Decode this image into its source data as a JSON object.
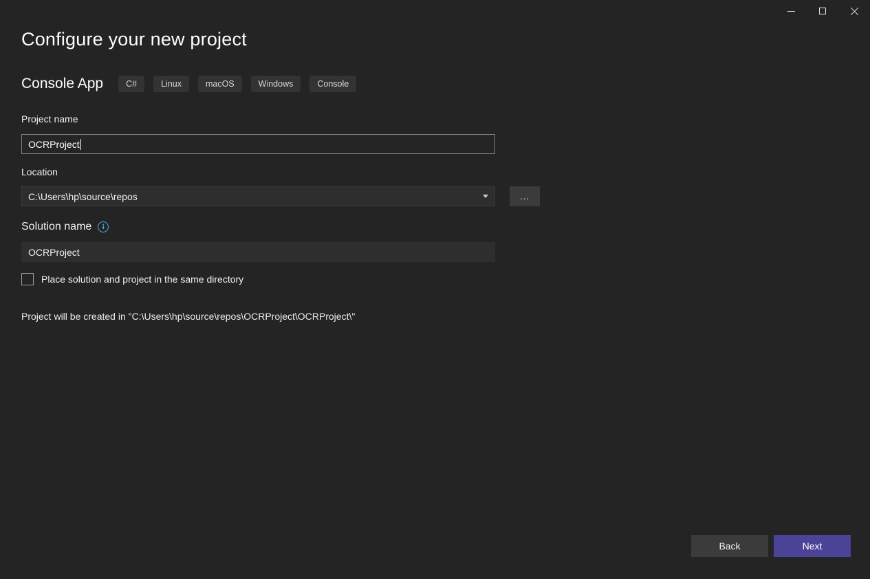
{
  "window": {
    "background": "#242424",
    "controls": {
      "minimize": "minimize-icon",
      "maximize": "maximize-icon",
      "close": "close-icon"
    }
  },
  "header": {
    "title": "Configure your new project"
  },
  "project_type": {
    "name": "Console App",
    "tags": [
      "C#",
      "Linux",
      "macOS",
      "Windows",
      "Console"
    ]
  },
  "form": {
    "project_name": {
      "label": "Project name",
      "value": "OCRProject"
    },
    "location": {
      "label": "Location",
      "value": "C:\\Users\\hp\\source\\repos",
      "browse_label": "..."
    },
    "solution_name": {
      "label": "Solution name",
      "value": "OCRProject",
      "info_glyph": "i"
    },
    "same_directory_checkbox": {
      "label": "Place solution and project in the same directory",
      "checked": false
    },
    "output_note": "Project will be created in \"C:\\Users\\hp\\source\\repos\\OCRProject\\OCRProject\\\""
  },
  "footer": {
    "back_label": "Back",
    "next_label": "Next"
  },
  "colors": {
    "accent": "#4B4397",
    "info_icon": "#45AEE5",
    "field_bg": "#2E2E2E",
    "tag_bg": "#333333",
    "secondary_button_bg": "#3B3B3B"
  }
}
